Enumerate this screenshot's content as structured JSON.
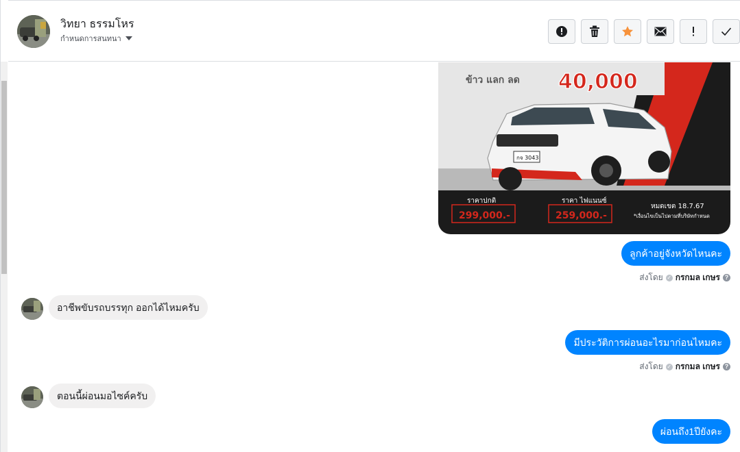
{
  "header": {
    "contact_name": "วิทยา ธรรมโหร",
    "subtitle": "กำหนดการสนทนา",
    "avatar_icon": "user-photo-icon",
    "toolbar": [
      {
        "name": "spam-button",
        "icon": "alert-circle-icon"
      },
      {
        "name": "delete-button",
        "icon": "trash-icon"
      },
      {
        "name": "star-button",
        "icon": "star-icon"
      },
      {
        "name": "mark-unread-button",
        "icon": "envelope-icon"
      },
      {
        "name": "follow-up-button",
        "icon": "exclamation-icon"
      },
      {
        "name": "mark-done-button",
        "icon": "checkmark-icon"
      }
    ]
  },
  "ad_image": {
    "headline_price": "40,000",
    "subtitle": "ข้าว แลก ลด",
    "plate": "กจ 3043",
    "normal_price_label": "ราคาปกติ",
    "normal_price": "299,000.-",
    "finance_price_label": "ราคา ไฟแนนซ์",
    "finance_price": "259,000.-",
    "expiry": "หมดเขต 18.7.67",
    "disclaimer": "*เงื่อนไขเป็นไปตามที่บริษัทกำหนด",
    "colors": {
      "red": "#d4271c",
      "dark": "#1a1a1a",
      "grey": "#bcbcbc"
    }
  },
  "messages": [
    {
      "direction": "out",
      "text": "ลูกค้าอยู่จังหวัดไหนคะ",
      "sent_by_label": "ส่งโดย",
      "agent": "กรกมล เกษร"
    },
    {
      "direction": "in",
      "text": "อาชีพขับรถบรรทุก ออกได้ไหมครับ"
    },
    {
      "direction": "out",
      "text": "มีประวัติการผ่อนอะไรมาก่อนไหมคะ",
      "sent_by_label": "ส่งโดย",
      "agent": "กรกมล เกษร"
    },
    {
      "direction": "in",
      "text": "ตอนนี้ผ่อนมอไซค์ครับ"
    },
    {
      "direction": "out",
      "text": "ผ่อนถึง1ปียังคะ"
    }
  ],
  "colors": {
    "accent": "#0084ff",
    "incoming_bubble": "#f1f0f0",
    "star": "#f7923b"
  }
}
